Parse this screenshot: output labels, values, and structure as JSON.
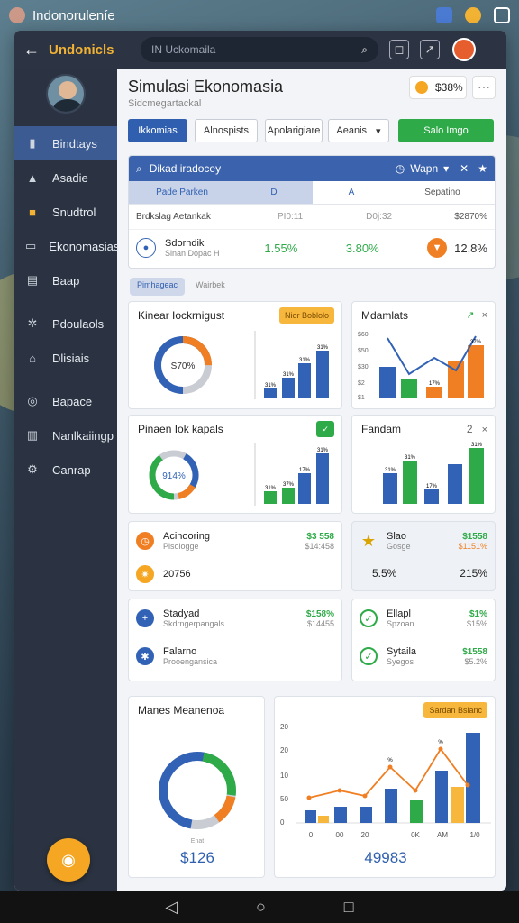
{
  "statusbar": {
    "title": "Indonoruleníe"
  },
  "topbar": {
    "brand": "Undonicls",
    "search_placeholder": "IN Uckomaila"
  },
  "sidebar": {
    "items": [
      {
        "label": "Bindtays",
        "icon": "building-icon",
        "active": true
      },
      {
        "label": "Asadie",
        "icon": "person-icon"
      },
      {
        "label": "Snudtrol",
        "icon": "folder-icon"
      },
      {
        "label": "Ekonomasias",
        "icon": "window-icon"
      },
      {
        "label": "Baap",
        "icon": "document-icon"
      },
      {
        "label": "Pdoulaols",
        "icon": "puzzle-icon"
      },
      {
        "label": "Dlisiais",
        "icon": "home-icon"
      },
      {
        "label": "Bapace",
        "icon": "chat-icon"
      },
      {
        "label": "Nanlkaiingp",
        "icon": "bank-icon"
      },
      {
        "label": "Canrap",
        "icon": "gear-icon"
      }
    ]
  },
  "header": {
    "title": "Simulasi Ekonomasia",
    "subtitle": "Sidcmegartackal",
    "pill_value": "$38%"
  },
  "buttons": {
    "b1": "Ikkomias",
    "b2": "Alnospists",
    "b3": "Apolarigiare",
    "b4": "Aeanis",
    "primary_green": "Salo Imgo"
  },
  "filter": {
    "search_label": "Dikad iradocey",
    "wapn": "Wapn",
    "tabs": [
      "Pade Parken",
      "D",
      "A",
      "Sepatino"
    ],
    "row1": {
      "label": "Brdkslag Aetankak",
      "c1": "PI0:11",
      "c2": "D0j:32",
      "c3": "$2870%"
    },
    "row2": {
      "name": "Sdorndik",
      "sub": "Sinan Dopac H",
      "v1": "1.55%",
      "v2": "3.80%",
      "v3": "12,8%"
    }
  },
  "tabs2": [
    "Pimhageac",
    "Wairbek"
  ],
  "cards": {
    "c1": {
      "title": "Kinear Iockrnigust",
      "badge": "Nior Boblolo",
      "donut_label": "S70%",
      "bar_labels": [
        "31%",
        "31%",
        "31%",
        "31%"
      ]
    },
    "c2": {
      "title": "Mdamlats",
      "y_ticks": [
        "$60",
        "$50",
        "$30",
        "$2",
        "$1"
      ],
      "bar_labels": [
        "37%",
        "37%",
        "17%",
        "37%"
      ]
    },
    "c3": {
      "title": "Pinaen Iok kapals",
      "badge": "✓",
      "donut_label": "914%",
      "bar_labels": [
        "31%",
        "37%",
        "17%",
        "31%"
      ]
    },
    "c4": {
      "title": "Fandam",
      "close": "2",
      "bar_labels": [
        "31%",
        "31%",
        "17%",
        "31%"
      ]
    }
  },
  "stats": {
    "a1": {
      "l1": "Acinooring",
      "l2": "Pisologge",
      "v1": "$3 558",
      "v2": "$14:458"
    },
    "a2": {
      "l1": "20756",
      "l2": ""
    },
    "b1": {
      "l1": "Slao",
      "l2": "Gosge",
      "v1": "$1558",
      "v2": "$1151%"
    },
    "b2": {
      "v1": "5.5%",
      "v2": "215%"
    },
    "c1": {
      "l1": "Stadyad",
      "l2": "Skdrngerpangals",
      "v1": "$158%",
      "v2": "$14455"
    },
    "c2": {
      "l1": "Falarno",
      "l2": "Prooengansica"
    },
    "d1": {
      "l1": "Ellapl",
      "l2": "Spzoan",
      "v1": "$1%",
      "v2": "$15%"
    },
    "d2": {
      "l1": "Sytaila",
      "l2": "Syegos",
      "v1": "$1558",
      "v2": "$5.2%"
    }
  },
  "bottom": {
    "left": {
      "title": "Manes Meanenoa",
      "small": "Enat",
      "value": "$126"
    },
    "right": {
      "badge": "Sardan Bslanc",
      "y_ticks": [
        "20",
        "20",
        "10",
        "50",
        "0"
      ],
      "x_ticks": [
        "0",
        "00",
        "20",
        "0K",
        "AM",
        "1/0"
      ],
      "line_labels": [
        "%",
        "%",
        "%"
      ],
      "value": "49983"
    }
  },
  "colors": {
    "blue": "#3162b5",
    "green": "#2faa48",
    "orange": "#f07f23",
    "yellow": "#f6b73c",
    "gray": "#c9ccd2"
  }
}
